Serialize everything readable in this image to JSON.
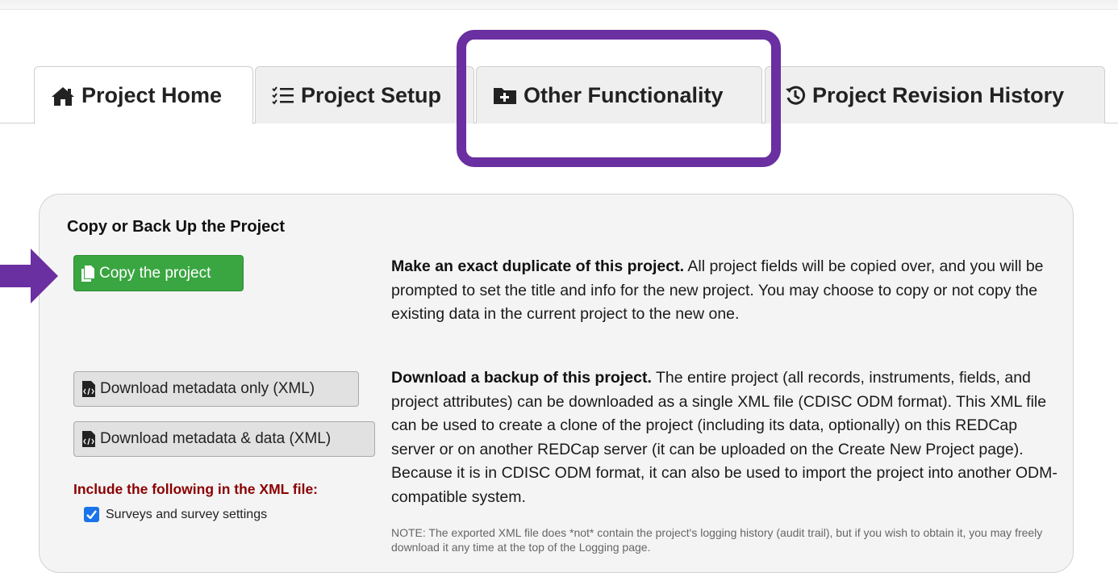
{
  "tabs": [
    {
      "label": "Project Home",
      "icon": "home-icon",
      "active": true
    },
    {
      "label": "Project Setup",
      "icon": "checklist-icon",
      "active": false
    },
    {
      "label": "Other Functionality",
      "icon": "folder-plus-icon",
      "active": false
    },
    {
      "label": "Project Revision History",
      "icon": "history-icon",
      "active": false
    }
  ],
  "panel": {
    "title": "Copy or Back Up the Project",
    "copy_button": "Copy the project",
    "copy_desc_bold": "Make an exact duplicate of this project.",
    "copy_desc": " All project fields will be copied over, and you will be prompted to set the title and info for the new project. You may choose to copy or not copy the existing data in the current project to the new one.",
    "download_meta_button": "Download metadata only (XML)",
    "download_data_button": "Download metadata & data (XML)",
    "backup_desc_bold": "Download a backup of this project.",
    "backup_desc": " The entire project (all records, instruments, fields, and project attributes) can be downloaded as a single XML file (CDISC ODM format). This XML file can be used to create a clone of the project (including its data, optionally) on this REDCap server or on another REDCap server (it can be uploaded on the Create New Project page). Because it is in CDISC ODM format, it can also be used to import the project into another ODM-compatible system.",
    "include_label": "Include the following in the XML file:",
    "surveys_checkbox_label": "Surveys and survey settings",
    "surveys_checked": true,
    "note": "NOTE: The exported XML file does *not* contain the project's logging history (audit trail), but if you wish to obtain it, you may freely download it any time at the top of the Logging page."
  },
  "colors": {
    "highlight": "#6a2fa0",
    "green_button": "#3aa641",
    "include_label": "#8b0000",
    "checkbox": "#1a73e8"
  }
}
